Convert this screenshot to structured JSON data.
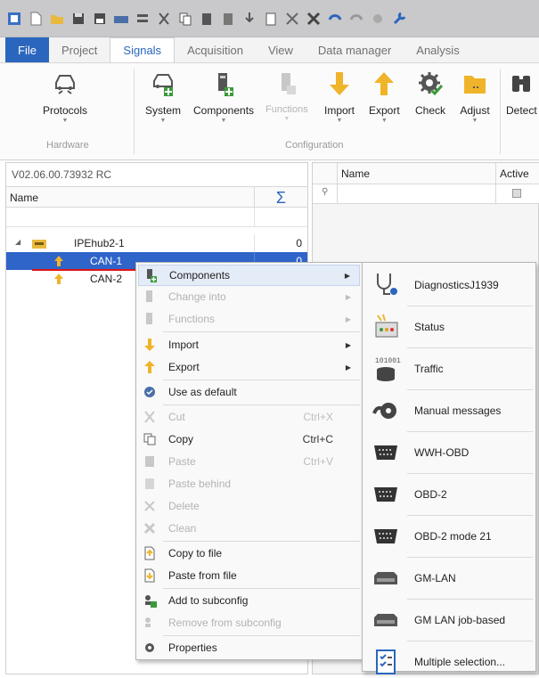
{
  "ribbon_tabs": [
    "File",
    "Project",
    "Signals",
    "Acquisition",
    "View",
    "Data manager",
    "Analysis"
  ],
  "ribbon": {
    "hardware": {
      "group_label": "Hardware",
      "protocols": "Protocols"
    },
    "configuration": {
      "group_label": "Configuration",
      "system": "System",
      "components": "Components",
      "functions": "Functions",
      "import": "Import",
      "export": "Export",
      "check": "Check",
      "adjust": "Adjust",
      "detect": "Detect"
    }
  },
  "tree": {
    "version": "V02.06.00.73932 RC",
    "column_name": "Name",
    "column_sigma": "Σ",
    "rows": [
      {
        "label": "IPEhub2-1",
        "value": "0"
      },
      {
        "label": "CAN-1",
        "value": "0"
      },
      {
        "label": "CAN-2",
        "value": ""
      }
    ]
  },
  "right_grid": {
    "col_name": "Name",
    "col_active": "Active"
  },
  "context_menu": {
    "components": "Components",
    "change_into": "Change into",
    "functions": "Functions",
    "import": "Import",
    "export": "Export",
    "use_as_default": "Use as default",
    "cut": "Cut",
    "cut_shortcut": "Ctrl+X",
    "copy": "Copy",
    "copy_shortcut": "Ctrl+C",
    "paste": "Paste",
    "paste_shortcut": "Ctrl+V",
    "paste_behind": "Paste behind",
    "delete": "Delete",
    "clean": "Clean",
    "copy_to_file": "Copy to file",
    "paste_from_file": "Paste from file",
    "add_to_subconfig": "Add to subconfig",
    "remove_from_subconfig": "Remove from subconfig",
    "properties": "Properties"
  },
  "submenu": [
    "DiagnosticsJ1939",
    "Status",
    "Traffic",
    "Manual messages",
    "WWH-OBD",
    "OBD-2",
    "OBD-2 mode 21",
    "GM-LAN",
    "GM LAN job-based",
    "Multiple selection..."
  ],
  "colors": {
    "accent": "#2a66bd",
    "selection": "#2f64c8",
    "annotation": "#e01414"
  }
}
